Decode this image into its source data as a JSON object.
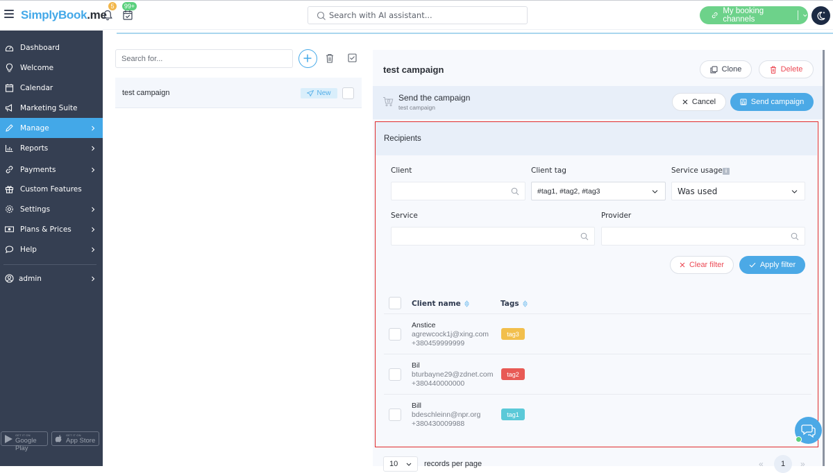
{
  "header": {
    "logo_prefix": "S",
    "logo_main": "implyBook",
    "logo_suffix": ".me",
    "notifications_count": "5",
    "bookings_count": "99+",
    "search_placeholder": "Search with AI assistant...",
    "channels_button": "My booking channels"
  },
  "sidebar": {
    "items": [
      {
        "label": "Dashboard",
        "icon": "dashboard-icon",
        "has_arrow": false,
        "active": false
      },
      {
        "label": "Welcome",
        "icon": "lightbulb-icon",
        "has_arrow": false,
        "active": false
      },
      {
        "label": "Calendar",
        "icon": "calendar-icon",
        "has_arrow": false,
        "active": false
      },
      {
        "label": "Marketing Suite",
        "icon": "megaphone-icon",
        "has_arrow": false,
        "active": false
      },
      {
        "label": "Manage",
        "icon": "pencil-icon",
        "has_arrow": true,
        "active": true
      },
      {
        "label": "Reports",
        "icon": "chart-icon",
        "has_arrow": true,
        "active": false
      },
      {
        "label": "Payments",
        "icon": "link-icon",
        "has_arrow": true,
        "active": false
      },
      {
        "label": "Custom Features",
        "icon": "gift-icon",
        "has_arrow": false,
        "active": false
      },
      {
        "label": "Settings",
        "icon": "gear-icon",
        "has_arrow": true,
        "active": false
      },
      {
        "label": "Plans & Prices",
        "icon": "money-icon",
        "has_arrow": true,
        "active": false
      },
      {
        "label": "Help",
        "icon": "chat-bubble-icon",
        "has_arrow": true,
        "active": false
      }
    ],
    "user": {
      "label": "admin",
      "icon": "user-circle-icon"
    },
    "stores": {
      "google_small": "GET IT ON",
      "google_big": "Google Play",
      "apple_small": "GET IT ON",
      "apple_big": "App Store"
    }
  },
  "campaign_list": {
    "search_placeholder": "Search for...",
    "items": [
      {
        "title": "test campaign",
        "status": "New"
      }
    ]
  },
  "campaign": {
    "title": "test campaign",
    "clone_label": "Clone",
    "delete_label": "Delete",
    "send_bar": {
      "title": "Send the campaign",
      "subtitle": "test campaign",
      "cancel_label": "Cancel",
      "send_label": "Send campaign"
    }
  },
  "recipients": {
    "heading": "Recipients",
    "filters": {
      "client_label": "Client",
      "client_value": "",
      "client_tag_label": "Client tag",
      "client_tag_value": "#tag1, #tag2, #tag3",
      "service_usage_label": "Service usage",
      "service_usage_value": "Was used",
      "service_label": "Service",
      "service_value": "",
      "provider_label": "Provider",
      "provider_value": "",
      "clear_label": "Clear filter",
      "apply_label": "Apply filter"
    },
    "table": {
      "columns": [
        "Client name",
        "Tags"
      ],
      "rows": [
        {
          "name": "Anstice",
          "email": "agrewcock1j@xing.com",
          "phone": "+380459999999",
          "tag": "tag3",
          "tag_color": "#f2bf4c"
        },
        {
          "name": "Bil",
          "email": "bturbayne29@zdnet.com",
          "phone": "+380440000000",
          "tag": "tag2",
          "tag_color": "#e85a55"
        },
        {
          "name": "Bill",
          "email": "bdeschleinn@npr.org",
          "phone": "+380430009988",
          "tag": "tag1",
          "tag_color": "#5bc9d8"
        }
      ]
    }
  },
  "pagination": {
    "per_page": "10",
    "per_page_label": "records per page",
    "prev": "«",
    "current_page": "1",
    "next": "»"
  },
  "colors": {
    "accent": "#43a8e8",
    "sidebar_bg": "#353f52",
    "success": "#6dd28a",
    "danger": "#ec4a55",
    "highlight_border": "#e02b2b"
  }
}
